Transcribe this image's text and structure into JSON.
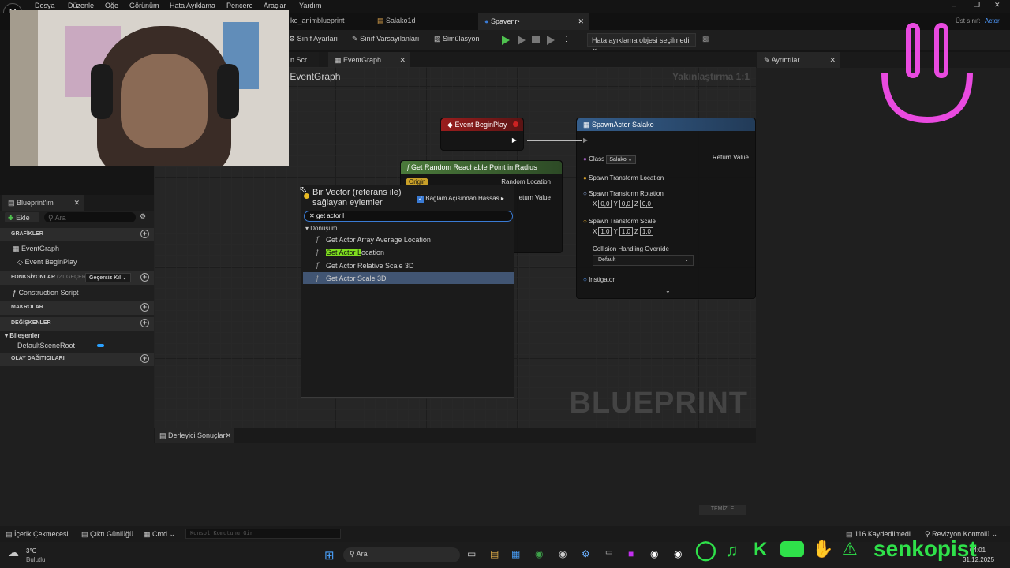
{
  "menu": [
    "Dosya",
    "Düzenle",
    "Öğe",
    "Görünüm",
    "Hata Ayıklama",
    "Pencere",
    "Araçlar",
    "Yardım"
  ],
  "tabs": [
    {
      "label": "ko_animblueprint"
    },
    {
      "label": "Salako1d"
    },
    {
      "label": "Spavenr•"
    }
  ],
  "parent_class": {
    "label": "Üst sınıf:",
    "value": "Actor"
  },
  "toolbar": {
    "class_settings": "Sınıf Ayarları",
    "class_defaults": "Sınıf Varsayılanları",
    "simulation": "Simülasyon",
    "debug_object": "Hata ayıklama objesi seçilmedi"
  },
  "graph_tabs": {
    "prev": "n Scr...",
    "active": "EventGraph"
  },
  "graph": {
    "header": "EventGraph",
    "zoom": "Yakınlaştırma 1:1",
    "watermark": "BLUEPRINT"
  },
  "nodes": {
    "begin_play": {
      "title": "Event BeginPlay"
    },
    "random_point": {
      "title": "Get Random Reachable Point in Radius",
      "pin_origin": "Origin",
      "pin_random_location": "Random Location",
      "pin_return_value": "eturn Value"
    },
    "spawn_actor": {
      "title": "SpawnActor Salako",
      "class_label": "Class",
      "class_value": "Salako",
      "return_value": "Return Value",
      "spawn_location": "Spawn Transform Location",
      "spawn_rotation": "Spawn Transform Rotation",
      "rotation": {
        "x": "0,0",
        "y": "0,0",
        "z": "0,0"
      },
      "spawn_scale": "Spawn Transform Scale",
      "scale": {
        "x": "1,0",
        "y": "1,0",
        "z": "1,0"
      },
      "collision_label": "Collision Handling Override",
      "collision_value": "Default",
      "instigator": "Instigator"
    }
  },
  "context_menu": {
    "title": "Bir Vector (referans ile) sağlayan eylemler",
    "context_sensitive": "Bağlam Açısından Hassas",
    "search_value": "get actor l",
    "category": "Dönüşüm",
    "items": [
      {
        "label": "Get Actor Array Average Location",
        "selected": false
      },
      {
        "label": "Get Actor Location",
        "highlight": "Get Actor L",
        "rest": "ocation",
        "selected": false
      },
      {
        "label": "Get Actor Relative Scale 3D",
        "selected": false
      },
      {
        "label": "Get Actor Scale 3D",
        "selected": true
      }
    ]
  },
  "details": {
    "tab": "Ayrıntılar"
  },
  "left_panel": {
    "tab": "Blueprint'im",
    "add": "Ekle",
    "search_placeholder": "Ara",
    "graphs": "GRAFİKLER",
    "event_graph": "EventGraph",
    "event_begin_play": "Event BeginPlay",
    "functions": "FONKSİYONLAR",
    "functions_count": "(21 GEÇERS",
    "override": "Geçersiz Kıl",
    "construction_script": "Construction Script",
    "macros": "MAKROLAR",
    "variables": "DEĞİŞKENLER",
    "components": "Bileşenler",
    "default_scene_root": "DefaultSceneRoot",
    "dispatchers": "OLAY DAĞITICILARI"
  },
  "compiler": {
    "tab": "Derleyici Sonuçları",
    "clear": "TEMİZLE"
  },
  "statusbar": {
    "content_drawer": "İçerik Çekmecesi",
    "output_log": "Çıktı Günlüğü",
    "cmd": "Cmd",
    "console_placeholder": "Konsol Komutunu Gir",
    "saved": "116 Kaydedilmedi",
    "revision": "Revizyon Kontrolü"
  },
  "taskbar": {
    "weather_temp": "3°C",
    "weather_desc": "Bulutlu",
    "search": "Ara",
    "time": "04:01",
    "date": "31.12.2025"
  },
  "overlay": {
    "username": "senkopist"
  },
  "colors": {
    "accent": "#3a7bd5",
    "event_header": "#8b1a1a",
    "function_header": "#3d6b3d",
    "spawn_header": "#2b4f78",
    "highlight": "#7fdf1f",
    "overlay_green": "#2fe14a",
    "overlay_pink": "#e94ae0"
  }
}
